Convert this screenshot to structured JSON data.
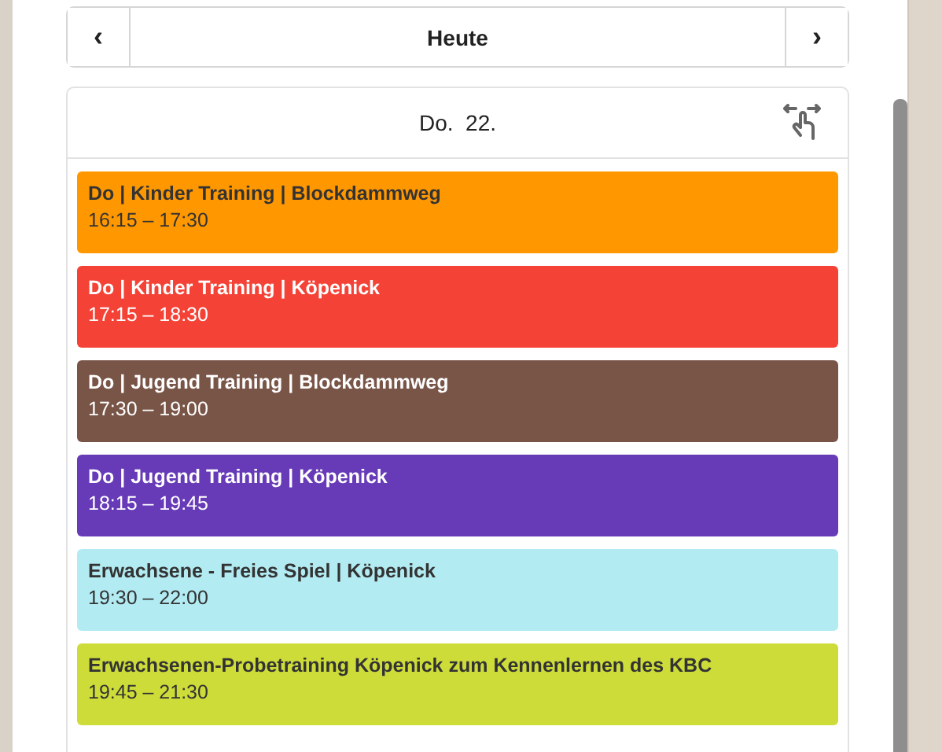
{
  "nav": {
    "prev": "‹",
    "today": "Heute",
    "next": "›"
  },
  "day": {
    "title": "Do.  22."
  },
  "events": [
    {
      "title": "Do | Kinder Training | Blockdammweg",
      "time": "16:15 – 17:30",
      "color": "#ff9800"
    },
    {
      "title": "Do | Kinder Training | Köpenick",
      "time": "17:15 – 18:30",
      "color": "#f44336"
    },
    {
      "title": "Do | Jugend Training | Blockdammweg",
      "time": "17:30 – 19:00",
      "color": "#795548"
    },
    {
      "title": "Do | Jugend Training | Köpenick",
      "time": "18:15 – 19:45",
      "color": "#673ab7"
    },
    {
      "title": "Erwachsene - Freies Spiel | Köpenick",
      "time": "19:30 – 22:00",
      "color": "#b2ebf2"
    },
    {
      "title": "Erwachsenen-Probetraining Köpenick zum Kennenlernen des KBC",
      "time": "19:45 – 21:30",
      "color": "#cddc39"
    }
  ]
}
